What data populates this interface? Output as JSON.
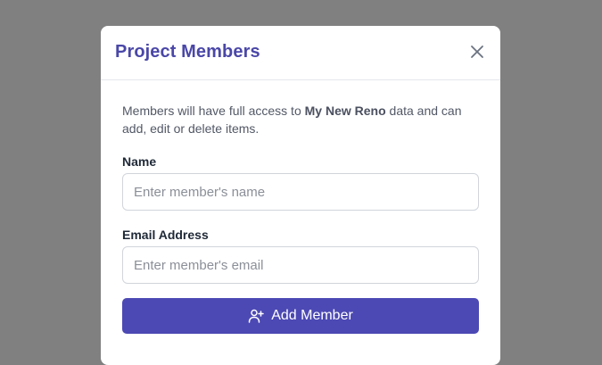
{
  "modal": {
    "title": "Project Members",
    "close_icon": "close-icon",
    "description": {
      "prefix": "Members will have full access to ",
      "project_name": "My New Reno",
      "suffix": " data and can add, edit or delete items."
    },
    "fields": {
      "name": {
        "label": "Name",
        "placeholder": "Enter member's name",
        "value": ""
      },
      "email": {
        "label": "Email Address",
        "placeholder": "Enter member's email",
        "value": ""
      }
    },
    "add_button": {
      "label": "Add Member",
      "icon": "user-plus-icon"
    }
  },
  "colors": {
    "overlay": "#808080",
    "accent": "#4c49b4",
    "title": "#4a47a8"
  }
}
